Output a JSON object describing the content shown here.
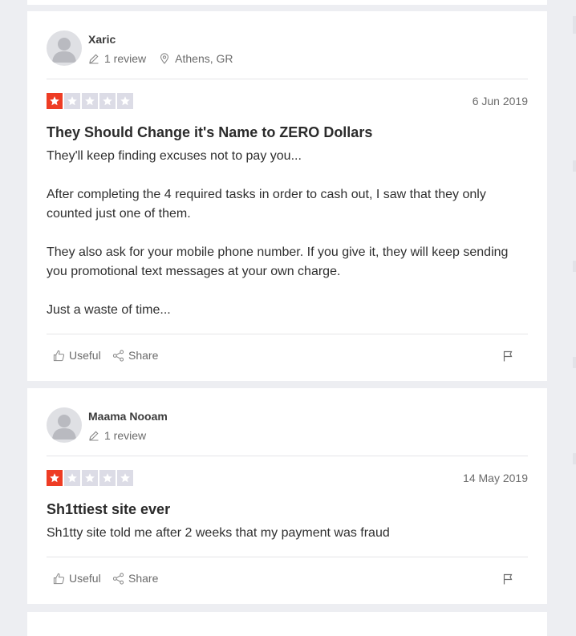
{
  "reviews": [
    {
      "name": "Xaric",
      "review_count": "1 review",
      "location": "Athens, GR",
      "rating": 1,
      "date": "6 Jun 2019",
      "title": "They Should Change it's Name to ZERO Dollars",
      "body": "They'll keep finding excuses not to pay you...\n\nAfter completing the 4 required tasks in order to cash out, I saw that they only counted just one of them.\n\nThey also ask for your mobile phone number. If you give it, they will keep sending you promotional text messages at your own charge.\n\nJust a waste of time...",
      "useful_label": "Useful",
      "share_label": "Share"
    },
    {
      "name": "Maama Nooam",
      "review_count": "1 review",
      "location": "",
      "rating": 1,
      "date": "14 May 2019",
      "title": "Sh1ttiest site ever",
      "body": "Sh1tty site told me after 2 weeks that my payment was fraud",
      "useful_label": "Useful",
      "share_label": "Share"
    }
  ],
  "colors": {
    "star_filled": "#ee3c24",
    "star_empty": "#dcdce6",
    "background": "#edeef2"
  },
  "icons": [
    "avatar-placeholder",
    "pencil-icon",
    "location-pin-icon",
    "star-icon",
    "thumbs-up-icon",
    "share-icon",
    "flag-icon"
  ]
}
